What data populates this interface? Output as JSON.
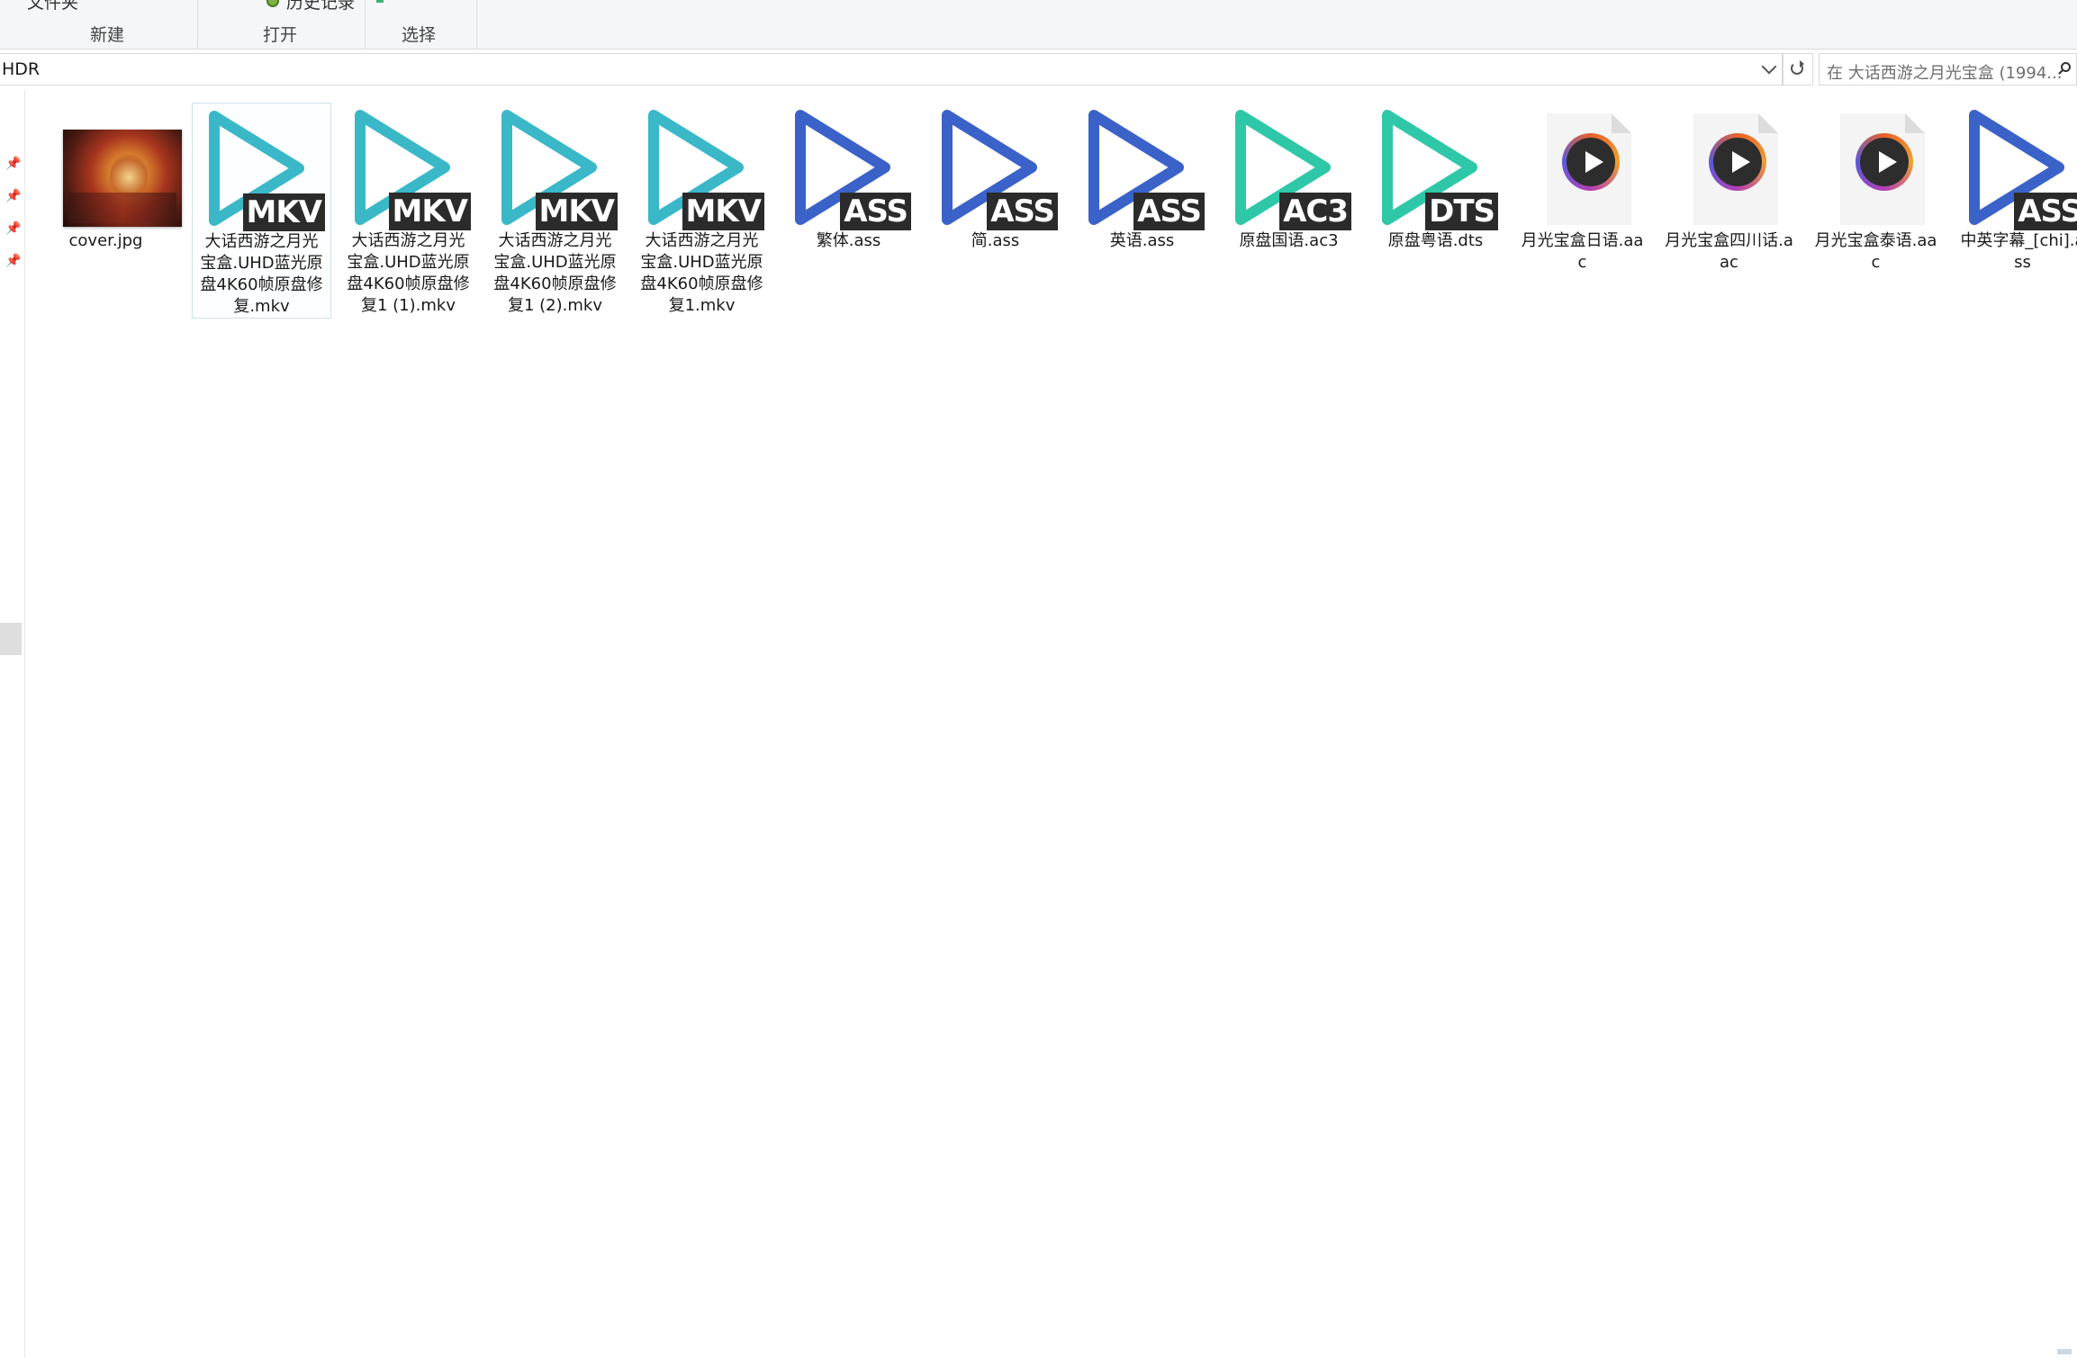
{
  "ribbon": {
    "top_folder": "文件夹",
    "top_history": "历史记录",
    "groups": {
      "new": "新建",
      "open": "打开",
      "select": "选择"
    }
  },
  "address": {
    "path": "HDR",
    "search_placeholder": "在 大话西游之月光宝盒 (1994..."
  },
  "files": [
    {
      "name": "cover.jpg",
      "kind": "image"
    },
    {
      "name": "大话西游之月光宝盒.UHD蓝光原盘4K60帧原盘修复.mkv",
      "kind": "video",
      "badge": "MKV",
      "color": "#3ab8c8",
      "selected": true
    },
    {
      "name": "大话西游之月光宝盒.UHD蓝光原盘4K60帧原盘修复1 (1).mkv",
      "kind": "video",
      "badge": "MKV",
      "color": "#3ab8c8"
    },
    {
      "name": "大话西游之月光宝盒.UHD蓝光原盘4K60帧原盘修复1 (2).mkv",
      "kind": "video",
      "badge": "MKV",
      "color": "#3ab8c8"
    },
    {
      "name": "大话西游之月光宝盒.UHD蓝光原盘4K60帧原盘修复1.mkv",
      "kind": "video",
      "badge": "MKV",
      "color": "#3ab8c8"
    },
    {
      "name": "繁体.ass",
      "kind": "subtitle",
      "badge": "ASS",
      "color": "#3a62c8"
    },
    {
      "name": "简.ass",
      "kind": "subtitle",
      "badge": "ASS",
      "color": "#3a62c8"
    },
    {
      "name": "英语.ass",
      "kind": "subtitle",
      "badge": "ASS",
      "color": "#3a62c8"
    },
    {
      "name": "原盘国语.ac3",
      "kind": "audio",
      "badge": "AC3",
      "color": "#2ec8a8"
    },
    {
      "name": "原盘粤语.dts",
      "kind": "audio",
      "badge": "DTS",
      "color": "#2ec8a8"
    },
    {
      "name": "月光宝盒日语.aac",
      "kind": "aac"
    },
    {
      "name": "月光宝盒四川话.aac",
      "kind": "aac"
    },
    {
      "name": "月光宝盒泰语.aac",
      "kind": "aac"
    },
    {
      "name": "中英字幕_[chi].ass",
      "kind": "subtitle",
      "badge": "ASS",
      "color": "#3a62c8"
    }
  ]
}
